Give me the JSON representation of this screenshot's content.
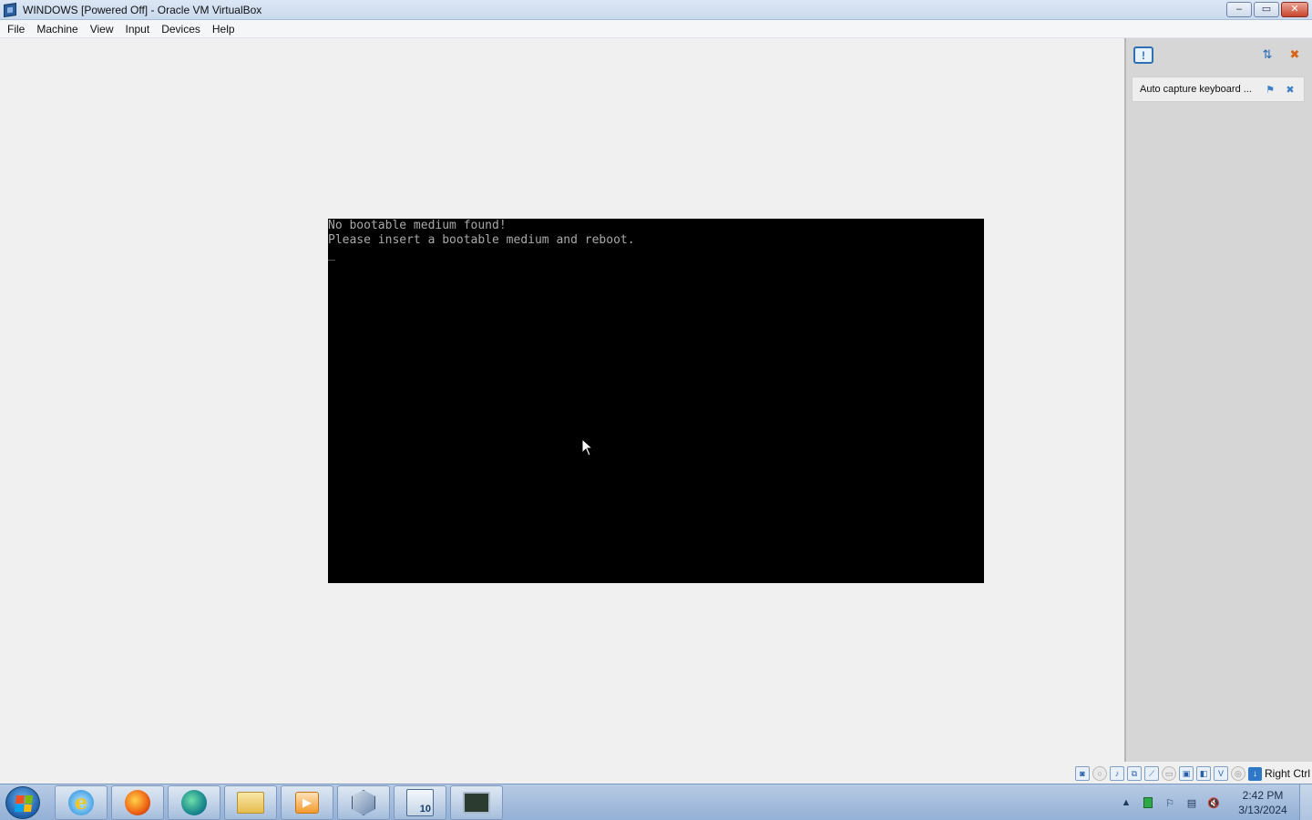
{
  "window": {
    "title": "WINDOWS [Powered Off] - Oracle VM VirtualBox",
    "controls": {
      "minimize": "–",
      "restore": "▭",
      "close": "✕"
    }
  },
  "menu": [
    "File",
    "Machine",
    "View",
    "Input",
    "Devices",
    "Help"
  ],
  "vm_screen": {
    "lines": [
      "No bootable medium found!",
      "Please insert a bootable medium and reboot.",
      "_"
    ],
    "background": "#000000",
    "text_color": "#a8a8a8"
  },
  "notification_panel": {
    "icon": "notification-bubble-icon",
    "notifications": [
      {
        "text": "Auto capture keyboard ..."
      }
    ]
  },
  "statusbar": {
    "icons": [
      "hard-disk-icon",
      "optical-drive-icon",
      "audio-icon",
      "network-icon",
      "usb-icon",
      "shared-folder-icon",
      "display-icon",
      "recording-icon",
      "vt-x-icon",
      "mouse-integration-icon",
      "host-key-icon"
    ],
    "host_key_label": "Right Ctrl"
  },
  "taskbar": {
    "apps": [
      "internet-explorer",
      "firefox",
      "edge",
      "file-explorer",
      "media-player",
      "virtualbox",
      "calculator",
      "monitor"
    ],
    "calc_label": "10",
    "clock": {
      "time": "2:42 PM",
      "date": "3/13/2024"
    }
  },
  "colors": {
    "titlebar": "#c9d9ee",
    "panel": "#d6d6d6",
    "taskbar": "#93b0d6"
  }
}
